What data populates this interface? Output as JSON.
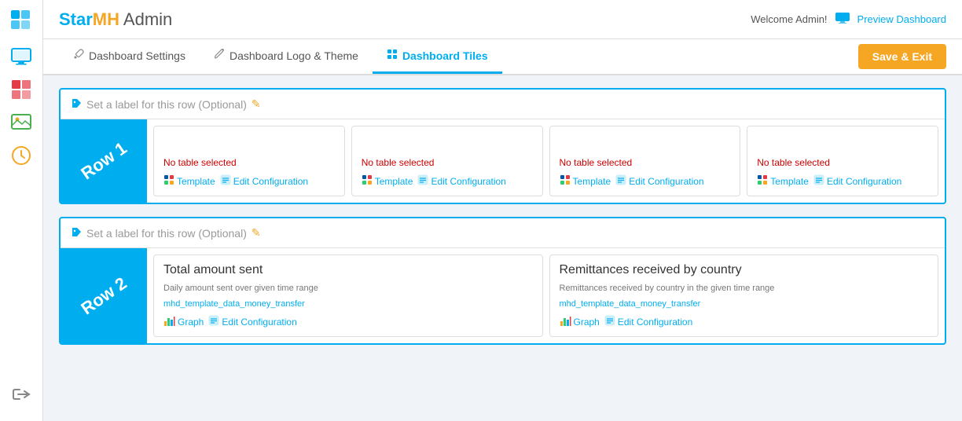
{
  "brand": {
    "star": "Star",
    "mh": "MH",
    "admin": " Admin"
  },
  "topbar": {
    "welcome": "Welcome Admin!",
    "preview_label": "Preview Dashboard"
  },
  "tabs": [
    {
      "id": "dashboard-settings",
      "label": "Dashboard Settings",
      "icon": "wrench",
      "active": false
    },
    {
      "id": "dashboard-logo-theme",
      "label": "Dashboard Logo & Theme",
      "icon": "paint",
      "active": false
    },
    {
      "id": "dashboard-tiles",
      "label": "Dashboard Tiles",
      "icon": "grid",
      "active": true
    }
  ],
  "toolbar": {
    "save_exit_label": "Save & Exit"
  },
  "rows": [
    {
      "id": "row1",
      "label": "Row 1",
      "row_label_placeholder": "Set a label for this row (Optional)",
      "tiles": [
        {
          "id": "tile1",
          "no_table": "No table selected",
          "action1": "Template",
          "action2": "Edit Configuration"
        },
        {
          "id": "tile2",
          "no_table": "No table selected",
          "action1": "Template",
          "action2": "Edit Configuration"
        },
        {
          "id": "tile3",
          "no_table": "No table selected",
          "action1": "Template",
          "action2": "Edit Configuration"
        },
        {
          "id": "tile4",
          "no_table": "No table selected",
          "action1": "Template",
          "action2": "Edit Configuration"
        }
      ]
    },
    {
      "id": "row2",
      "label": "Row 2",
      "row_label_placeholder": "Set a label for this row (Optional)",
      "tiles": [
        {
          "id": "tile5",
          "wide": true,
          "title": "Total amount sent",
          "desc": "Daily amount sent over given time range",
          "link": "mhd_template_data_money_transfer",
          "action1": "Graph",
          "action2": "Edit Configuration"
        },
        {
          "id": "tile6",
          "wide": true,
          "title": "Remittances received by country",
          "desc": "Remittances received by country in the given time range",
          "link": "mhd_template_data_money_transfer",
          "action1": "Graph",
          "action2": "Edit Configuration"
        }
      ]
    }
  ],
  "sidebar": {
    "items": [
      {
        "id": "star-logo",
        "icon": "star-grid"
      },
      {
        "id": "monitor",
        "icon": "monitor"
      },
      {
        "id": "grid-red",
        "icon": "grid-red"
      },
      {
        "id": "image",
        "icon": "image"
      },
      {
        "id": "clock",
        "icon": "clock"
      }
    ],
    "logout": {
      "id": "logout",
      "icon": "logout-arrow"
    }
  }
}
